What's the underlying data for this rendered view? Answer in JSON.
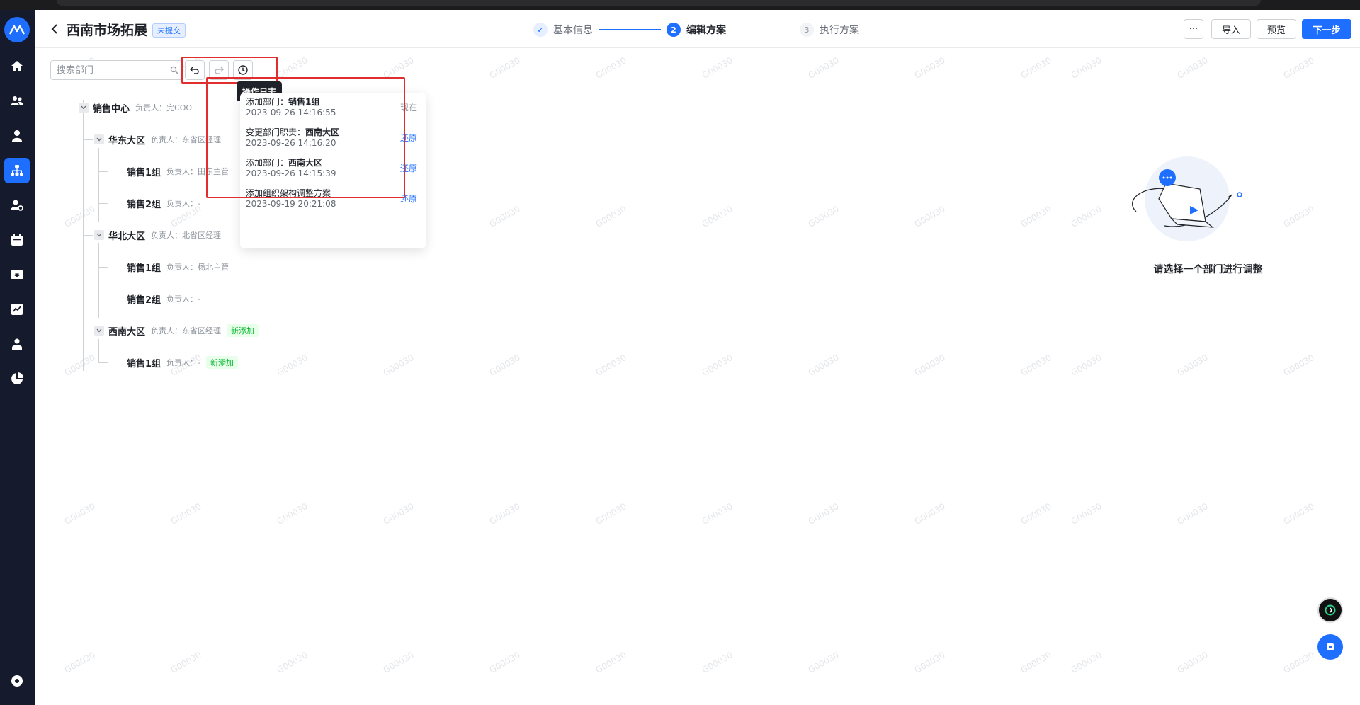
{
  "header": {
    "title": "西南市场拓展",
    "status": "未提交",
    "steps": [
      {
        "num": "✓",
        "label": "基本信息"
      },
      {
        "num": "2",
        "label": "编辑方案"
      },
      {
        "num": "3",
        "label": "执行方案"
      }
    ],
    "more_label": "···",
    "import_label": "导入",
    "preview_label": "预览",
    "next_label": "下一步"
  },
  "toolbar": {
    "search_placeholder": "搜索部门",
    "tooltip": "操作日志"
  },
  "tree": {
    "root": {
      "name": "销售中心",
      "owner": "负责人：完COO"
    },
    "east": {
      "name": "华东大区",
      "owner": "负责人：东省区经理"
    },
    "east_g1": {
      "name": "销售1组",
      "owner": "负责人：田东主管"
    },
    "east_g2": {
      "name": "销售2组",
      "owner": "负责人：-"
    },
    "north": {
      "name": "华北大区",
      "owner": "负责人：北省区经理"
    },
    "north_g1": {
      "name": "销售1组",
      "owner": "负责人：杨北主管"
    },
    "north_g2": {
      "name": "销售2组",
      "owner": "负责人：-"
    },
    "southwest": {
      "name": "西南大区",
      "owner": "负责人：东省区经理",
      "tag": "新添加"
    },
    "sw_g1": {
      "name": "销售1组",
      "owner": "负责人：-",
      "tag": "新添加"
    }
  },
  "log": [
    {
      "prefix": "添加部门：",
      "target": "销售1组",
      "time": "2023-09-26 14:16:55",
      "action": "现在"
    },
    {
      "prefix": "变更部门职责：",
      "target": "西南大区",
      "time": "2023-09-26 14:16:20",
      "action": "还原"
    },
    {
      "prefix": "添加部门：",
      "target": "西南大区",
      "time": "2023-09-26 14:15:39",
      "action": "还原"
    },
    {
      "prefix": "添加组织架构调整方案",
      "target": "",
      "time": "2023-09-19 20:21:08",
      "action": "还原"
    }
  ],
  "empty_state": {
    "text": "请选择一个部门进行调整"
  },
  "watermark": "G00030",
  "colors": {
    "accent": "#1e6fff",
    "sidebar": "#151b2c",
    "new_tag": "#00b42a",
    "highlight": "#e02e2e"
  }
}
